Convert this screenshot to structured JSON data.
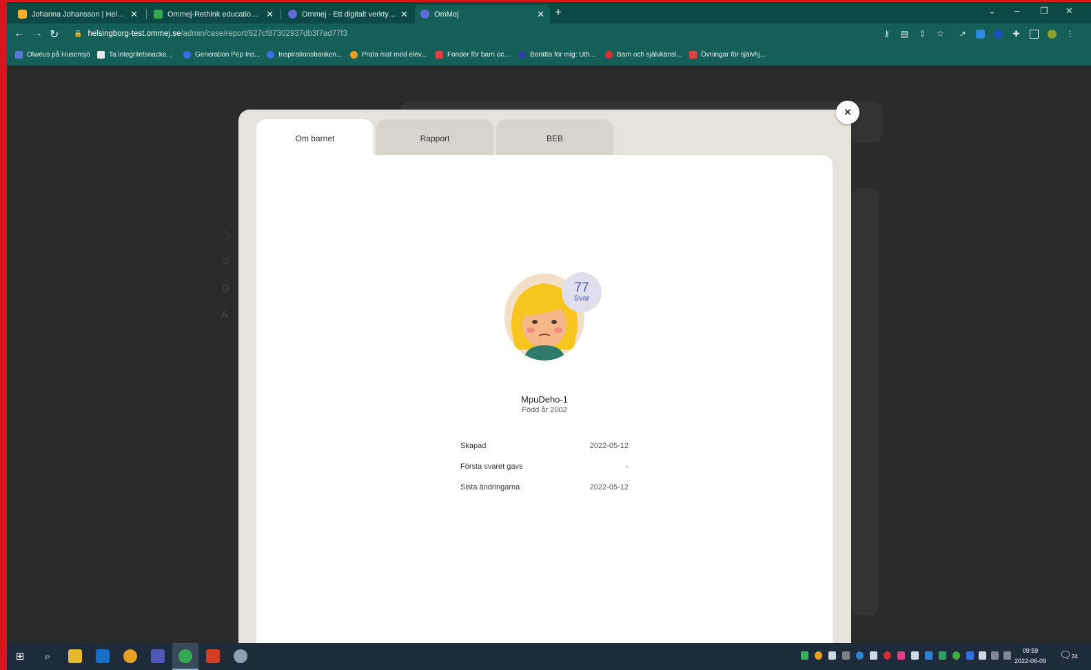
{
  "browser": {
    "tabs": [
      {
        "title": "Johanna Johansson | Helsingbor",
        "favicon_color": "#f2b233",
        "active": false
      },
      {
        "title": "Ommej-Rethink education med",
        "favicon_color": "#34a853",
        "active": false
      },
      {
        "title": "Ommej - Ett digitalt verktyg för",
        "favicon_color": "#5f6bd8",
        "active": false
      },
      {
        "title": "OmMej",
        "favicon_color": "#5f6bd8",
        "active": true
      }
    ],
    "new_tab_label": "+",
    "address": {
      "host": "helsingborg-test.ommej.se",
      "path": "/admin/case/report/627cf87302937db3f7ad77f3"
    },
    "bookmarks": [
      {
        "label": "Olweus på Husensjö",
        "color": "#5a7ad8"
      },
      {
        "label": "Ta integritetsnacke...",
        "color": "#e8e8e8"
      },
      {
        "label": "Generation Pep Ins...",
        "color": "#3a6ee8"
      },
      {
        "label": "Inspirationsbanken...",
        "color": "#3a6ee8"
      },
      {
        "label": "Prata mat med elev...",
        "color": "#e8a020"
      },
      {
        "label": "Fonder för barn oc...",
        "color": "#e04040"
      },
      {
        "label": "Berätta för mig: Uth...",
        "color": "#3040a0"
      },
      {
        "label": "Barn och självkänsl...",
        "color": "#d83030"
      },
      {
        "label": "Övningar för självhj...",
        "color": "#e04040"
      }
    ]
  },
  "modal": {
    "tabs": [
      {
        "label": "Om barnet",
        "active": true
      },
      {
        "label": "Rapport",
        "active": false
      },
      {
        "label": "BEB",
        "active": false
      }
    ],
    "close_label": "×",
    "badge": {
      "count": "77",
      "label": "Svar"
    },
    "child": {
      "name": "MpuDeho-1",
      "born": "Född år 2002"
    },
    "info": [
      {
        "label": "Skapad",
        "value": "2022-05-12"
      },
      {
        "label": "Första svaret gavs",
        "value": "-"
      },
      {
        "label": "Sista ändringarna",
        "value": "2022-05-12"
      }
    ]
  },
  "taskbar": {
    "clock_time": "09:59",
    "clock_date": "2022-06-09",
    "notification_count": "24"
  }
}
